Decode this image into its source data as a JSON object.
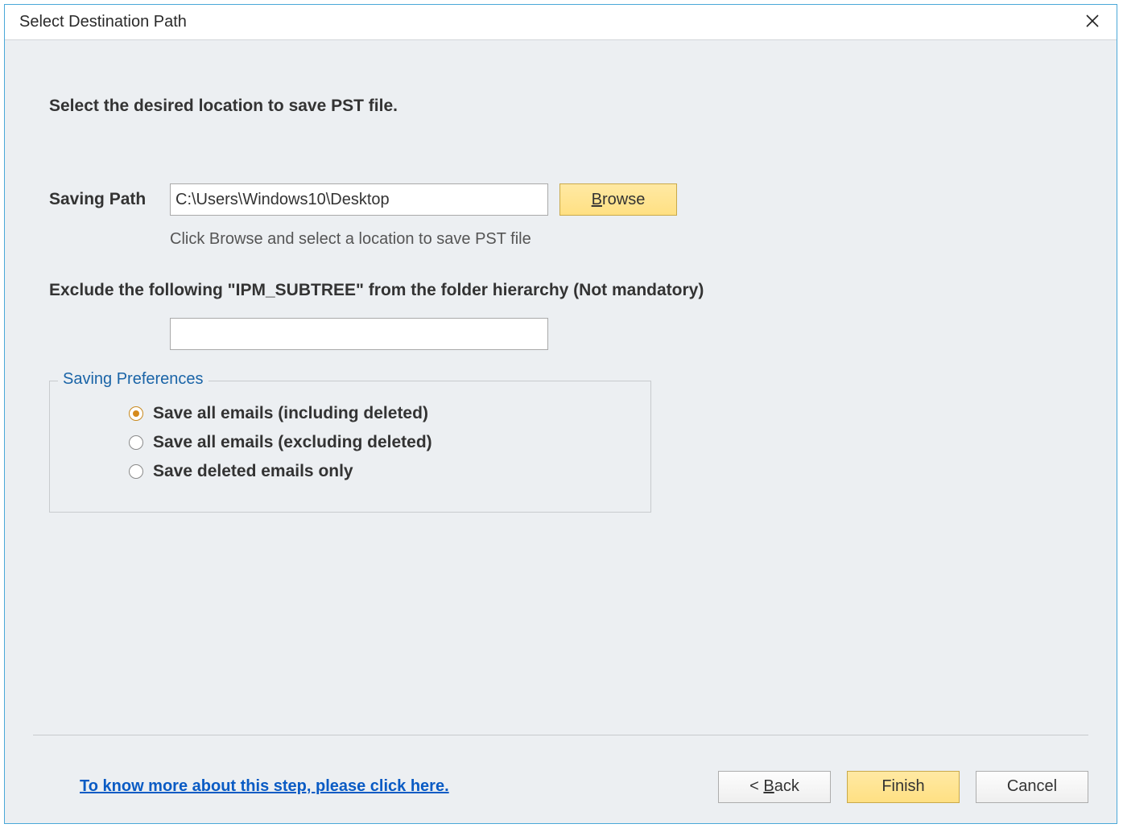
{
  "titleBar": {
    "title": "Select Destination Path"
  },
  "content": {
    "instruction": "Select the desired location to save PST file.",
    "savingPathLabel": "Saving Path",
    "savingPathValue": "C:\\Users\\Windows10\\Desktop",
    "browseLabel": "Browse",
    "hint": "Click Browse and select a location to save PST file",
    "excludeLabel": "Exclude the following \"IPM_SUBTREE\" from the folder hierarchy (Not mandatory)",
    "excludeValue": "",
    "preferences": {
      "legend": "Saving Preferences",
      "options": [
        {
          "label": "Save all emails (including deleted)",
          "checked": true
        },
        {
          "label": "Save all emails (excluding deleted)",
          "checked": false
        },
        {
          "label": "Save deleted emails only",
          "checked": false
        }
      ]
    }
  },
  "footer": {
    "helpLink": "To know more about this step, please click here.",
    "backLabel": "< Back",
    "finishLabel": "Finish",
    "cancelLabel": "Cancel"
  }
}
